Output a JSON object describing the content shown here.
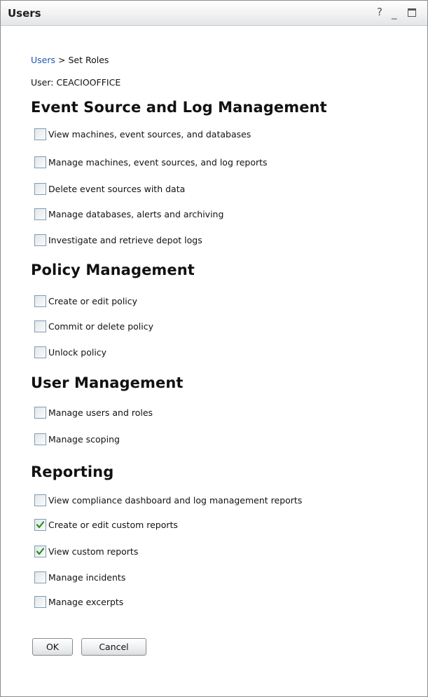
{
  "window": {
    "title": "Users",
    "help_label": "?",
    "minimize_label": "_"
  },
  "breadcrumb": {
    "link": "Users",
    "separator": ">",
    "current": "Set Roles"
  },
  "user": {
    "label": "User:",
    "name": "CEACIOOFFICE"
  },
  "sections": [
    {
      "title": "Event Source and Log Management",
      "options": [
        {
          "label": "View machines, event sources, and databases",
          "checked": false
        },
        {
          "label": "Manage machines, event sources, and log reports",
          "checked": false
        },
        {
          "label": "Delete event sources with data",
          "checked": false
        },
        {
          "label": "Manage databases, alerts and archiving",
          "checked": false
        },
        {
          "label": "Investigate and retrieve depot logs",
          "checked": false
        }
      ]
    },
    {
      "title": "Policy Management",
      "options": [
        {
          "label": "Create or edit policy",
          "checked": false
        },
        {
          "label": "Commit or delete policy",
          "checked": false
        },
        {
          "label": "Unlock policy",
          "checked": false
        }
      ]
    },
    {
      "title": "User Management",
      "options": [
        {
          "label": "Manage users and roles",
          "checked": false
        },
        {
          "label": "Manage scoping",
          "checked": false
        }
      ]
    },
    {
      "title": "Reporting",
      "options": [
        {
          "label": "View compliance dashboard and log management reports",
          "checked": false
        },
        {
          "label": "Create or edit custom reports",
          "checked": true
        },
        {
          "label": "View custom reports",
          "checked": true
        },
        {
          "label": "Manage incidents",
          "checked": false
        },
        {
          "label": "Manage excerpts",
          "checked": false
        }
      ]
    }
  ],
  "buttons": {
    "ok": "OK",
    "cancel": "Cancel"
  },
  "colors": {
    "link": "#1c56b0",
    "checkmark": "#2a8c1e",
    "checkbox_border": "#7f9db9"
  },
  "icons": {
    "help": "question-mark",
    "minimize": "minimize",
    "maximize": "maximize",
    "checkmark": "check"
  }
}
